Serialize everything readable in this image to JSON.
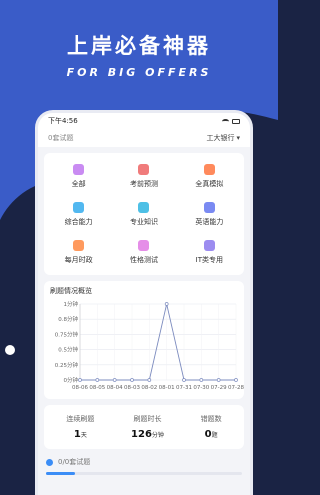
{
  "promo": {
    "title": "上岸必备神器",
    "subtitle": "FOR BIG OFFERS"
  },
  "colors": {
    "background": "#1a2344",
    "wave": "#3a5cc8",
    "accent": "#3b8df6",
    "chart_line": "#7d8cbf"
  },
  "status_bar": {
    "time": "下午4:56"
  },
  "top_bar": {
    "question_count": "0套试题",
    "bank_name": "工大银行",
    "dropdown_icon": "caret-down-icon"
  },
  "menu": [
    {
      "label": "全部",
      "icon": "all-icon",
      "color": "#c98bf2"
    },
    {
      "label": "考前预测",
      "icon": "forecast-icon",
      "color": "#f07b7b"
    },
    {
      "label": "全真模拟",
      "icon": "mock-exam-icon",
      "color": "#ff8a5c"
    },
    {
      "label": "综合能力",
      "icon": "ability-icon",
      "color": "#52b8f0"
    },
    {
      "label": "专业知识",
      "icon": "graduation-cap-icon",
      "color": "#4ec0e6"
    },
    {
      "label": "英语能力",
      "icon": "english-icon",
      "color": "#7a8af2"
    },
    {
      "label": "每月时政",
      "icon": "news-icon",
      "color": "#ff9a5e"
    },
    {
      "label": "性格测试",
      "icon": "personality-icon",
      "color": "#e58ee8"
    },
    {
      "label": "IT类专用",
      "icon": "it-icon",
      "color": "#9c8cf0"
    }
  ],
  "chart_card": {
    "title": "刷题情况概览"
  },
  "chart_data": {
    "type": "line",
    "title": "刷题情况概览",
    "xlabel": "",
    "ylabel": "",
    "categories": [
      "08-06",
      "08-05",
      "08-04",
      "08-03",
      "08-02",
      "08-01",
      "07-31",
      "07-30",
      "07-29",
      "07-28"
    ],
    "values": [
      0,
      0,
      0,
      0,
      0,
      1,
      0,
      0,
      0,
      0
    ],
    "y_ticks": [
      "0分钟",
      "0.25分钟",
      "0.5分钟",
      "0.75分钟",
      "0.8分钟",
      "1分钟"
    ],
    "ylim": [
      0,
      1
    ],
    "grid": true
  },
  "stats": [
    {
      "label": "连续刷题",
      "value": "1",
      "unit": "天"
    },
    {
      "label": "刷题时长",
      "value": "126",
      "unit": "分钟"
    },
    {
      "label": "错题数",
      "value": "0",
      "unit": "题"
    }
  ],
  "progress": {
    "label": "0/0套试题",
    "fraction": 0.15
  }
}
